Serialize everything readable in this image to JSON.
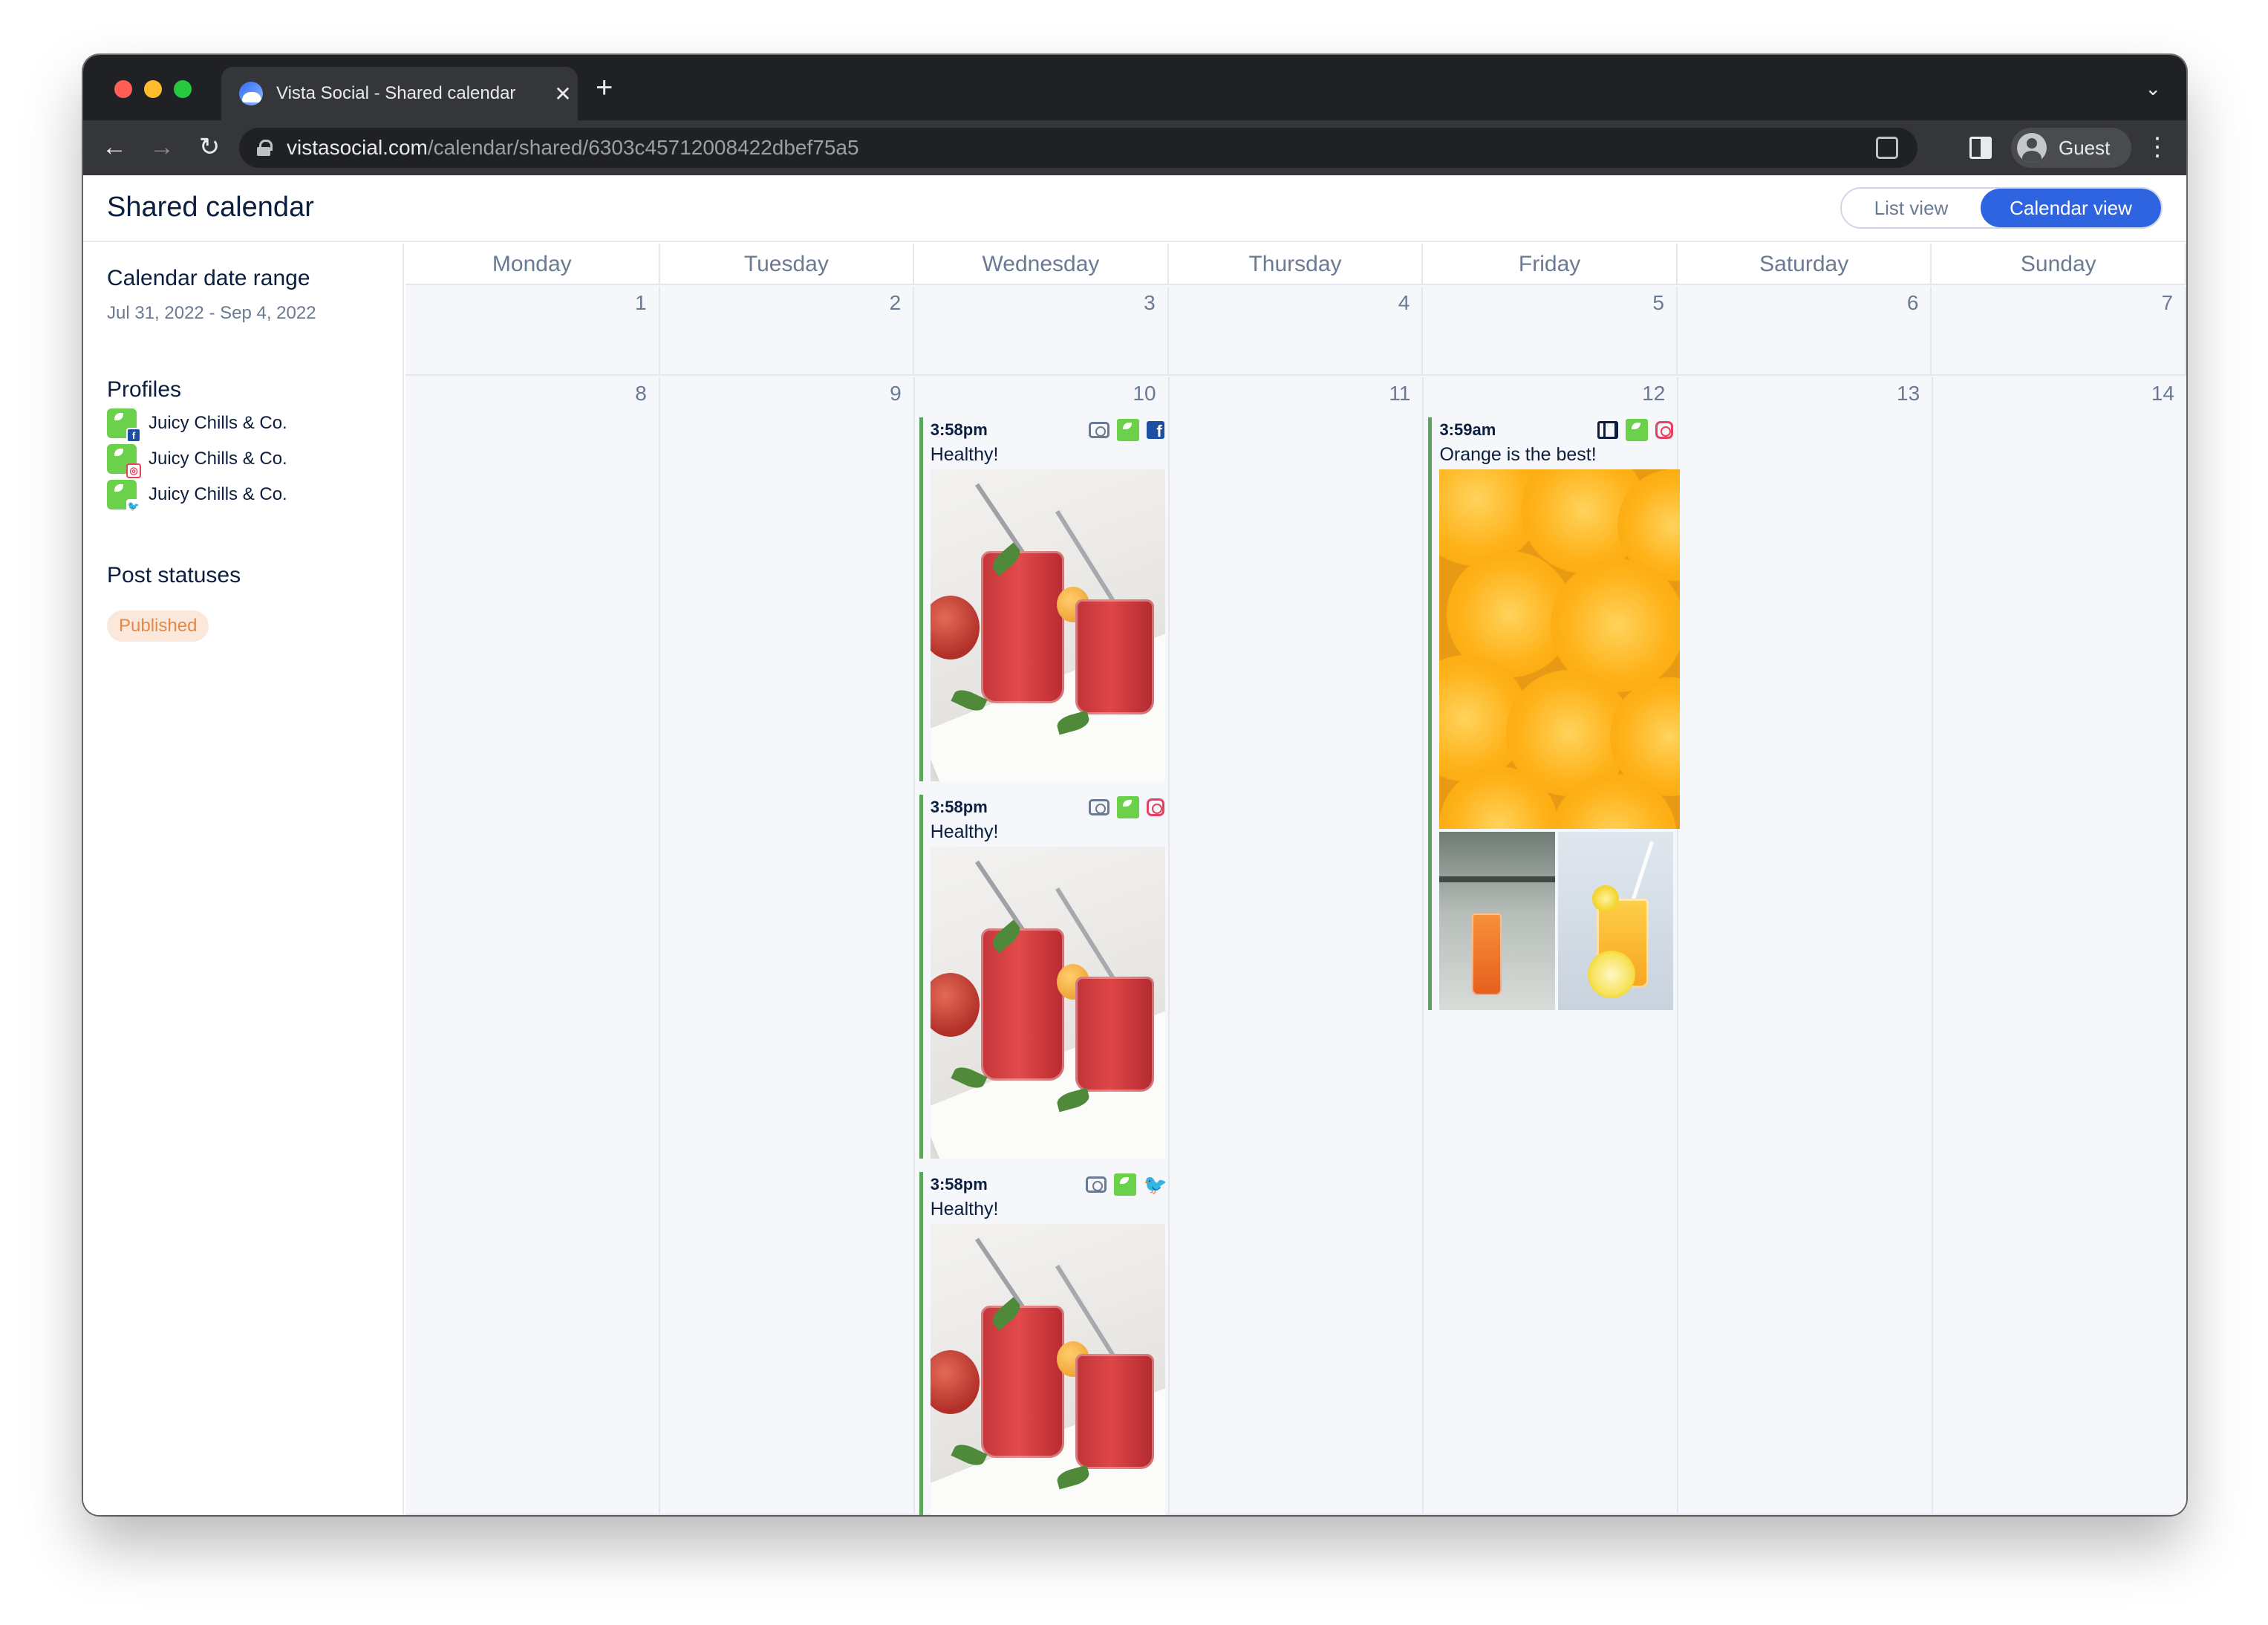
{
  "browser": {
    "tab_title": "Vista Social - Shared calendar",
    "tab_close": "✕",
    "new_tab": "+",
    "tab_dropdown": "⌄",
    "url_host": "vistasocial.com",
    "url_path": "/calendar/shared/6303c45712008422dbef75a5",
    "profile_label": "Guest",
    "menu": "⋮",
    "back": "←",
    "forward": "→",
    "reload": "↻"
  },
  "header": {
    "title": "Shared calendar",
    "list_view_label": "List view",
    "calendar_view_label": "Calendar view",
    "active_view": "calendar"
  },
  "sidebar": {
    "date_range_title": "Calendar date range",
    "date_range_value": "Jul 31, 2022 - Sep 4, 2022",
    "profiles_title": "Profiles",
    "profiles": [
      {
        "name": "Juicy Chills & Co.",
        "network": "facebook"
      },
      {
        "name": "Juicy Chills & Co.",
        "network": "instagram"
      },
      {
        "name": "Juicy Chills & Co.",
        "network": "twitter"
      }
    ],
    "statuses_title": "Post statuses",
    "statuses": [
      "Published"
    ]
  },
  "calendar": {
    "weekdays": [
      "Monday",
      "Tuesday",
      "Wednesday",
      "Thursday",
      "Friday",
      "Saturday",
      "Sunday"
    ],
    "week1_days": [
      "1",
      "2",
      "3",
      "4",
      "5",
      "6",
      "7"
    ],
    "week2_days": [
      "8",
      "9",
      "10",
      "11",
      "12",
      "13",
      "14"
    ],
    "posts": [
      {
        "day": "10",
        "time": "3:58pm",
        "text": "Healthy!",
        "media_type": "camera-icon",
        "network": "facebook",
        "image": "smoothie-jars"
      },
      {
        "day": "10",
        "time": "3:58pm",
        "text": "Healthy!",
        "media_type": "camera-icon",
        "network": "instagram",
        "image": "smoothie-jars"
      },
      {
        "day": "10",
        "time": "3:58pm",
        "text": "Healthy!",
        "media_type": "camera-icon",
        "network": "twitter",
        "image": "smoothie-jars"
      },
      {
        "day": "12",
        "time": "3:59am",
        "text": "Orange is the best!",
        "media_type": "carousel-icon",
        "network": "instagram",
        "image": "orange-slices"
      }
    ]
  },
  "colors": {
    "accent": "#2f64e0",
    "brand_green": "#6bd14a",
    "published_text": "#e3894a",
    "published_bg": "#fbe8da",
    "post_border": "#5aa65a",
    "text_dark": "#0b1e3e"
  }
}
